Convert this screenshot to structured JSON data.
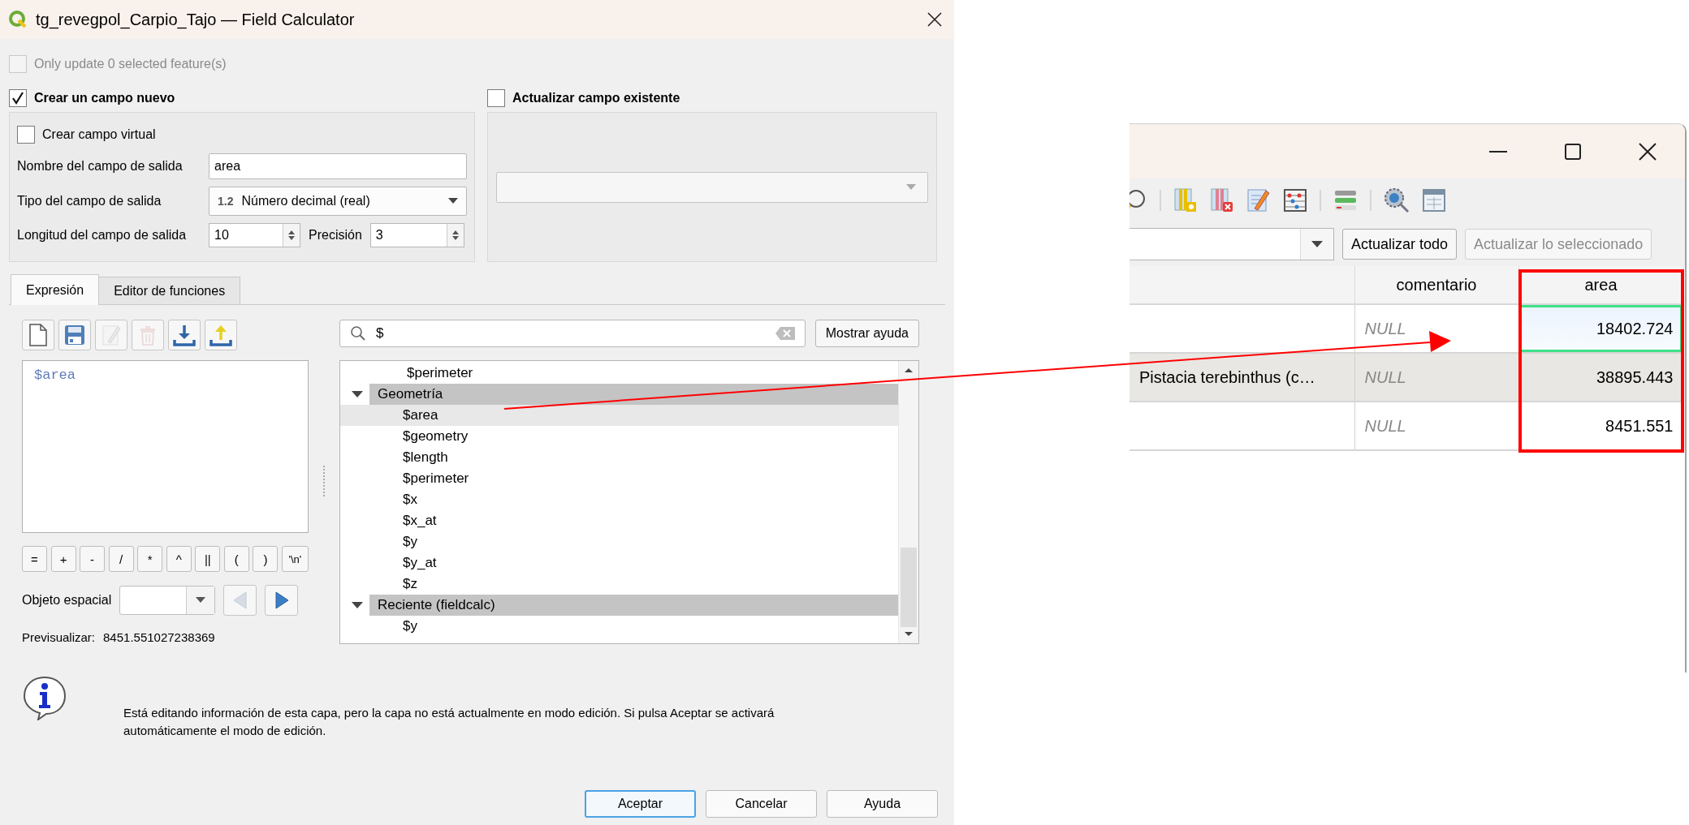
{
  "dialog": {
    "title": "tg_revegpol_Carpio_Tajo — Field Calculator",
    "only_selected": {
      "label": "Only update 0 selected feature(s)",
      "checked": false,
      "disabled": true
    },
    "new_field": {
      "label": "Crear un campo nuevo",
      "checked": true,
      "virtual": {
        "label": "Crear campo virtual",
        "checked": false
      },
      "name": {
        "label": "Nombre del campo de salida",
        "value": "area"
      },
      "type": {
        "label": "Tipo del campo de salida",
        "type_badge": "1.2",
        "value": "Número decimal (real)"
      },
      "length": {
        "label": "Longitud del campo de salida",
        "value": "10"
      },
      "precision": {
        "label": "Precisión",
        "value": "3"
      }
    },
    "update_field": {
      "label": "Actualizar campo existente",
      "checked": false
    },
    "tabs": [
      {
        "label": "Expresión",
        "selected": true
      },
      {
        "label": "Editor de funciones",
        "selected": false
      }
    ],
    "expression_toolbar": [
      {
        "kind": "new",
        "disabled": false
      },
      {
        "kind": "save",
        "disabled": false
      },
      {
        "kind": "edit",
        "disabled": true
      },
      {
        "kind": "delete",
        "disabled": true
      },
      {
        "kind": "import",
        "disabled": false
      },
      {
        "kind": "export",
        "disabled": false
      }
    ],
    "expression": "$area",
    "operators": [
      "=",
      "+",
      "-",
      "/",
      "*",
      "^",
      "||",
      "(",
      ")",
      "'\\n'"
    ],
    "feature": {
      "label": "Objeto espacial",
      "previous_disabled": true,
      "next_disabled": false
    },
    "preview": {
      "label": "Previsualizar:",
      "value": "8451.551027238369"
    },
    "search": {
      "value": "$"
    },
    "help_button": "Mostrar ayuda",
    "function_tree": [
      {
        "kind": "item",
        "label": "$perimeter",
        "selected": false
      },
      {
        "kind": "group",
        "label": "Geometría",
        "expanded": true,
        "selected": false,
        "children": [
          {
            "kind": "item",
            "label": "$area",
            "selected": true
          },
          {
            "kind": "item",
            "label": "$geometry",
            "selected": false
          },
          {
            "kind": "item",
            "label": "$length",
            "selected": false
          },
          {
            "kind": "item",
            "label": "$perimeter",
            "selected": false
          },
          {
            "kind": "item",
            "label": "$x",
            "selected": false
          },
          {
            "kind": "item",
            "label": "$x_at",
            "selected": false
          },
          {
            "kind": "item",
            "label": "$y",
            "selected": false
          },
          {
            "kind": "item",
            "label": "$y_at",
            "selected": false
          },
          {
            "kind": "item",
            "label": "$z",
            "selected": false
          }
        ]
      },
      {
        "kind": "group",
        "label": "Reciente (fieldcalc)",
        "expanded": true,
        "selected": false,
        "children": [
          {
            "kind": "item",
            "label": "$y",
            "selected": false
          }
        ]
      }
    ],
    "message": "Está editando información de esta capa, pero la capa no está actualmente en modo edición. Si pulsa Aceptar se activará automáticamente el modo de edición.",
    "buttons": [
      {
        "label": "Aceptar",
        "default": true
      },
      {
        "label": "Cancelar",
        "default": false
      },
      {
        "label": "Ayuda",
        "default": false
      }
    ]
  },
  "attribute_table": {
    "toolbar": [
      {
        "kind": "magnifier"
      },
      {
        "kind": "separator"
      },
      {
        "kind": "add_column"
      },
      {
        "kind": "delete_column"
      },
      {
        "kind": "field_calculator"
      },
      {
        "kind": "abacus"
      },
      {
        "kind": "separator"
      },
      {
        "kind": "conditional"
      },
      {
        "kind": "separator"
      },
      {
        "kind": "actions"
      },
      {
        "kind": "form_view"
      }
    ],
    "buttons": [
      {
        "label": "Actualizar todo",
        "disabled": false
      },
      {
        "label": "Actualizar lo seleccionado",
        "disabled": true
      }
    ],
    "columns": [
      {
        "label": "comentario"
      },
      {
        "label": "area"
      }
    ],
    "rows": [
      {
        "focused": true,
        "cells": [
          {
            "text": "NULL",
            "is_null": true
          },
          {
            "text": "18402.724",
            "is_null": false
          }
        ]
      },
      {
        "focused": false,
        "column_1": "Pistacia terebinthus (c…",
        "cells": [
          {
            "text": "NULL",
            "is_null": true
          },
          {
            "text": "38895.443",
            "is_null": false
          }
        ]
      },
      {
        "focused": false,
        "cells": [
          {
            "text": "NULL",
            "is_null": true
          },
          {
            "text": "8451.551",
            "is_null": false
          }
        ]
      }
    ]
  }
}
